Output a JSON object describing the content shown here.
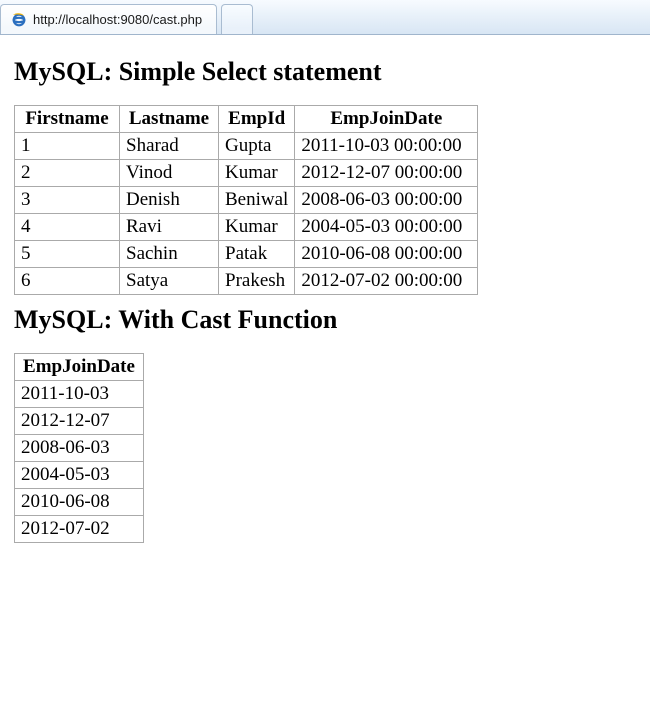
{
  "browser": {
    "url": "http://localhost:9080/cast.php",
    "favicon_name": "ie-browser-icon"
  },
  "section1": {
    "heading": "MySQL: Simple Select statement",
    "columns": [
      "Firstname",
      "Lastname",
      "EmpId",
      "EmpJoinDate"
    ],
    "rows": [
      {
        "firstname": "1",
        "lastname": "Sharad",
        "empid": "Gupta",
        "joindate": "2011-10-03 00:00:00"
      },
      {
        "firstname": "2",
        "lastname": "Vinod",
        "empid": "Kumar",
        "joindate": "2012-12-07 00:00:00"
      },
      {
        "firstname": "3",
        "lastname": "Denish",
        "empid": "Beniwal",
        "joindate": "2008-06-03 00:00:00"
      },
      {
        "firstname": "4",
        "lastname": "Ravi",
        "empid": "Kumar",
        "joindate": "2004-05-03 00:00:00"
      },
      {
        "firstname": "5",
        "lastname": "Sachin",
        "empid": "Patak",
        "joindate": "2010-06-08 00:00:00"
      },
      {
        "firstname": "6",
        "lastname": "Satya",
        "empid": "Prakesh",
        "joindate": "2012-07-02 00:00:00"
      }
    ]
  },
  "section2": {
    "heading": "MySQL: With Cast Function",
    "columns": [
      "EmpJoinDate"
    ],
    "rows": [
      {
        "joindate": "2011-10-03"
      },
      {
        "joindate": "2012-12-07"
      },
      {
        "joindate": "2008-06-03"
      },
      {
        "joindate": "2004-05-03"
      },
      {
        "joindate": "2010-06-08"
      },
      {
        "joindate": "2012-07-02"
      }
    ]
  }
}
